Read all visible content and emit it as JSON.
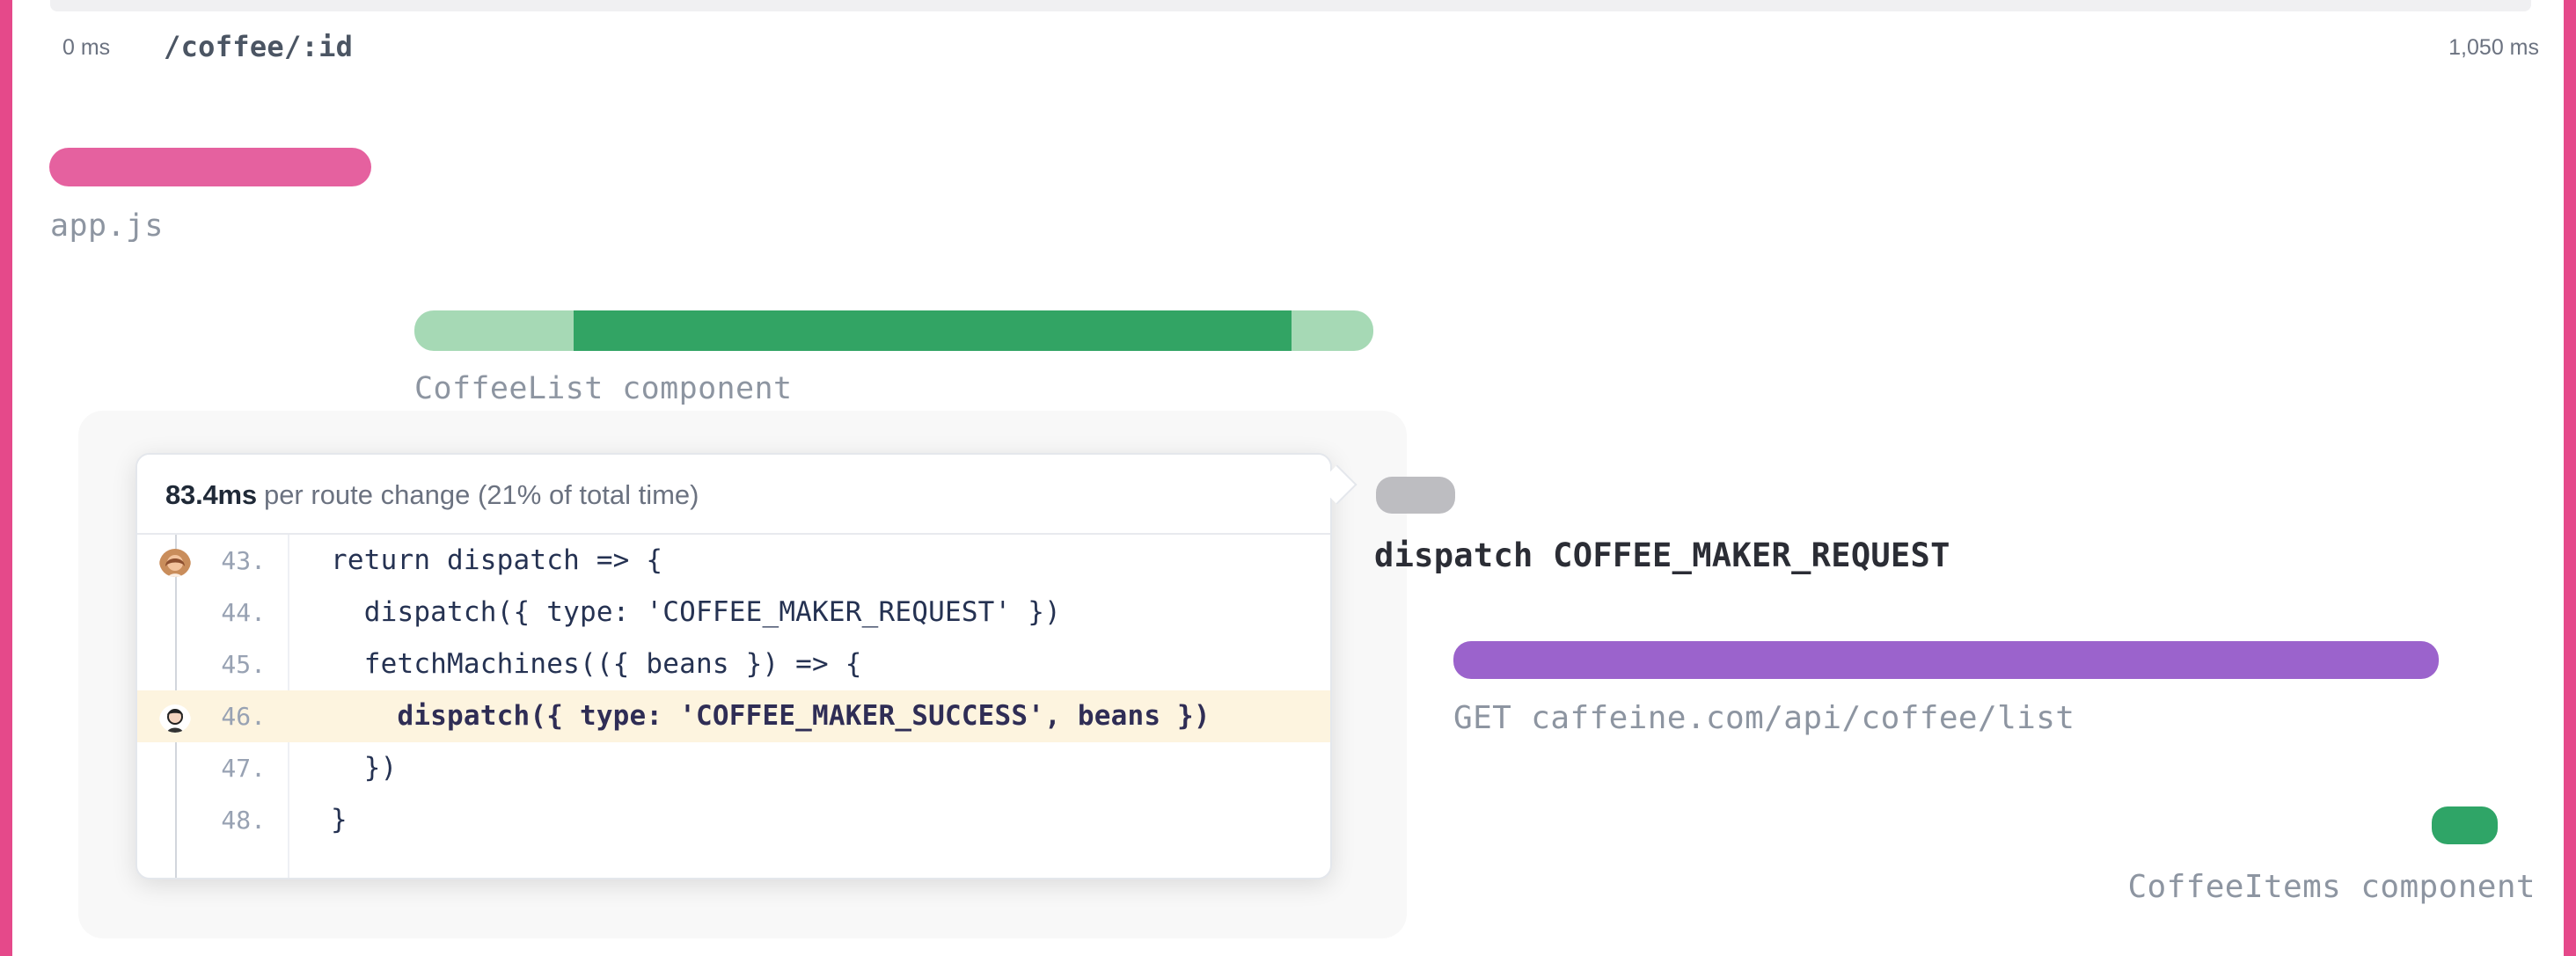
{
  "header": {
    "start_time": "0 ms",
    "route": "/coffee/:id",
    "end_time": "1,050 ms"
  },
  "timeline": {
    "app": {
      "label": "app.js",
      "color": "#e5619f"
    },
    "coffee_list": {
      "label": "CoffeeList component",
      "color_main": "#32a464",
      "color_light": "#a6d9b5"
    },
    "dispatch": {
      "label": "dispatch COFFEE_MAKER_REQUEST",
      "color": "#bdbdc1"
    },
    "request": {
      "label": "GET caffeine.com/api/coffee/list",
      "color": "#9b63cc"
    },
    "coffee_items": {
      "label": "CoffeeItems component",
      "color": "#2fa567"
    }
  },
  "popover": {
    "time": "83.4ms",
    "summary": "per route change (21% of total time)",
    "lines": [
      {
        "number": "43.",
        "code": "return dispatch => {",
        "author_icon": "avatar-woman-icon"
      },
      {
        "number": "44.",
        "code": "  dispatch({ type: 'COFFEE_MAKER_REQUEST' })",
        "author_icon": ""
      },
      {
        "number": "45.",
        "code": "  fetchMachines(({ beans }) => {",
        "author_icon": ""
      },
      {
        "number": "46.",
        "code": "    dispatch({ type: 'COFFEE_MAKER_SUCCESS', beans })",
        "author_icon": "avatar-man-icon"
      },
      {
        "number": "47.",
        "code": "  })",
        "author_icon": ""
      },
      {
        "number": "48.",
        "code": "}",
        "author_icon": ""
      }
    ]
  },
  "colors": {
    "frame": "#e5498a",
    "highlight": "#fdf4df"
  }
}
